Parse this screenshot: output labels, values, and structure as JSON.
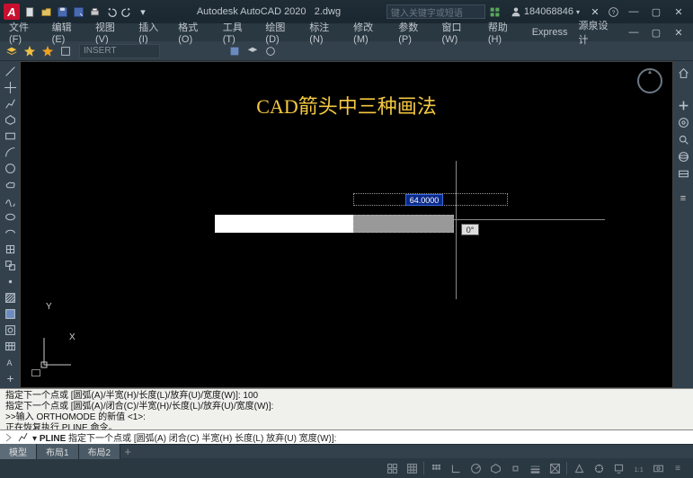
{
  "title": {
    "app": "Autodesk AutoCAD 2020",
    "doc": "2.dwg"
  },
  "search_placeholder": "键入关键字或短语",
  "user_id": "184068846",
  "menus": [
    "文件(F)",
    "编辑(E)",
    "视图(V)",
    "插入(I)",
    "格式(O)",
    "工具(T)",
    "绘图(D)",
    "标注(N)",
    "修改(M)",
    "参数(P)",
    "窗口(W)",
    "帮助(H)",
    "Express",
    "源泉设计"
  ],
  "insert_placeholder": "INSERT",
  "canvas": {
    "title_text": "CAD箭头中三种画法",
    "dim_value": "64.0000",
    "angle_value": "0°",
    "ucs_y": "Y",
    "ucs_x": "X"
  },
  "cmd_history": [
    "指定下一个点或 [圆弧(A)/半宽(H)/长度(L)/放弃(U)/宽度(W)]: 100",
    "指定下一个点或 [圆弧(A)/闭合(C)/半宽(H)/长度(L)/放弃(U)/宽度(W)]:",
    ">>输入 ORTHOMODE 的新值 <1>:",
    "正在恢复执行 PLINE 命令。"
  ],
  "cmd_prompt": {
    "cmd": "PLINE",
    "text": "指定下一个点或 [",
    "opts": [
      "圆弧(A)",
      "闭合(C)",
      "半宽(H)",
      "长度(L)",
      "放弃(U)",
      "宽度(W)"
    ],
    "tail": "]:"
  },
  "tabs": {
    "model": "模型",
    "layout1": "布局1",
    "layout2": "布局2"
  }
}
